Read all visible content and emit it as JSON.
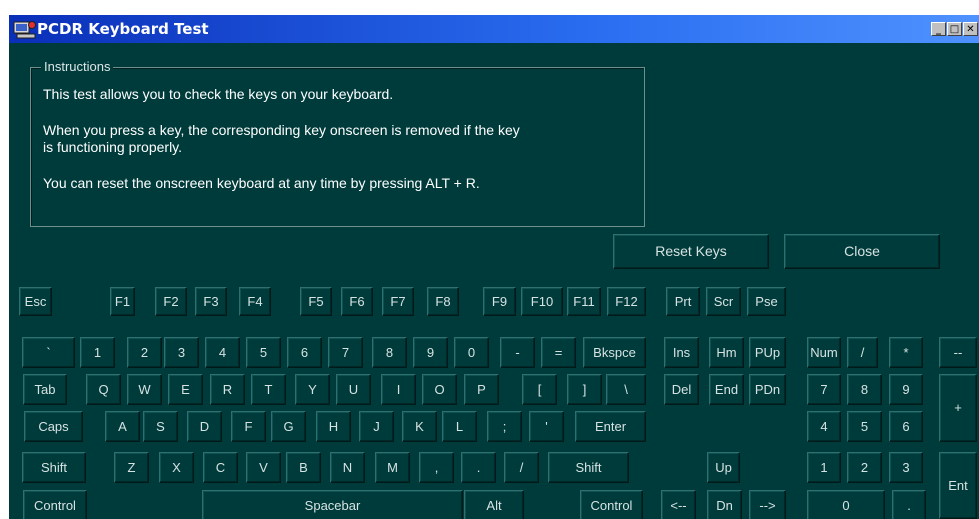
{
  "window": {
    "title": "PCDR Keyboard Test",
    "controls": {
      "minimize": "_",
      "maximize": "□",
      "close": "✕"
    }
  },
  "instructions": {
    "legend": "Instructions",
    "lines": [
      "This test allows you to check the keys on your keyboard.",
      "When you press a key, the corresponding key onscreen is removed if the key",
      "is functioning properly.",
      "You can reset the onscreen keyboard at any time by pressing ALT + R."
    ]
  },
  "buttons": {
    "reset": "Reset Keys",
    "close": "Close"
  },
  "keys": [
    {
      "id": "esc",
      "label": "Esc"
    },
    {
      "id": "f1",
      "label": "F1"
    },
    {
      "id": "f2",
      "label": "F2"
    },
    {
      "id": "f3",
      "label": "F3"
    },
    {
      "id": "f4",
      "label": "F4"
    },
    {
      "id": "f5",
      "label": "F5"
    },
    {
      "id": "f6",
      "label": "F6"
    },
    {
      "id": "f7",
      "label": "F7"
    },
    {
      "id": "f8",
      "label": "F8"
    },
    {
      "id": "f9",
      "label": "F9"
    },
    {
      "id": "f10",
      "label": "F10"
    },
    {
      "id": "f11",
      "label": "F11"
    },
    {
      "id": "f12",
      "label": "F12"
    },
    {
      "id": "prt",
      "label": "Prt"
    },
    {
      "id": "scr",
      "label": "Scr"
    },
    {
      "id": "pse",
      "label": "Pse"
    },
    {
      "id": "backtick",
      "label": "`"
    },
    {
      "id": "1",
      "label": "1"
    },
    {
      "id": "2",
      "label": "2"
    },
    {
      "id": "3",
      "label": "3"
    },
    {
      "id": "4",
      "label": "4"
    },
    {
      "id": "5",
      "label": "5"
    },
    {
      "id": "6",
      "label": "6"
    },
    {
      "id": "7",
      "label": "7"
    },
    {
      "id": "8",
      "label": "8"
    },
    {
      "id": "9",
      "label": "9"
    },
    {
      "id": "0",
      "label": "0"
    },
    {
      "id": "minus",
      "label": "-"
    },
    {
      "id": "equals",
      "label": "="
    },
    {
      "id": "bkspce",
      "label": "Bkspce"
    },
    {
      "id": "ins",
      "label": "Ins"
    },
    {
      "id": "hm",
      "label": "Hm"
    },
    {
      "id": "pup",
      "label": "PUp"
    },
    {
      "id": "num",
      "label": "Num"
    },
    {
      "id": "num-div",
      "label": "/"
    },
    {
      "id": "num-mul",
      "label": "*"
    },
    {
      "id": "num-minus",
      "label": "--"
    },
    {
      "id": "tab",
      "label": "Tab"
    },
    {
      "id": "q",
      "label": "Q"
    },
    {
      "id": "w",
      "label": "W"
    },
    {
      "id": "e",
      "label": "E"
    },
    {
      "id": "r",
      "label": "R"
    },
    {
      "id": "t",
      "label": "T"
    },
    {
      "id": "y",
      "label": "Y"
    },
    {
      "id": "u",
      "label": "U"
    },
    {
      "id": "i",
      "label": "I"
    },
    {
      "id": "o",
      "label": "O"
    },
    {
      "id": "p",
      "label": "P"
    },
    {
      "id": "lbracket",
      "label": "["
    },
    {
      "id": "rbracket",
      "label": "]"
    },
    {
      "id": "backslash",
      "label": "\\"
    },
    {
      "id": "del",
      "label": "Del"
    },
    {
      "id": "end",
      "label": "End"
    },
    {
      "id": "pdn",
      "label": "PDn"
    },
    {
      "id": "num7",
      "label": "7"
    },
    {
      "id": "num8",
      "label": "8"
    },
    {
      "id": "num9",
      "label": "9"
    },
    {
      "id": "num-plus",
      "label": "+"
    },
    {
      "id": "caps",
      "label": "Caps"
    },
    {
      "id": "a",
      "label": "A"
    },
    {
      "id": "s",
      "label": "S"
    },
    {
      "id": "d",
      "label": "D"
    },
    {
      "id": "f",
      "label": "F"
    },
    {
      "id": "g",
      "label": "G"
    },
    {
      "id": "h",
      "label": "H"
    },
    {
      "id": "j",
      "label": "J"
    },
    {
      "id": "k",
      "label": "K"
    },
    {
      "id": "l",
      "label": "L"
    },
    {
      "id": "semicolon",
      "label": ";"
    },
    {
      "id": "quote",
      "label": "'"
    },
    {
      "id": "enter",
      "label": "Enter"
    },
    {
      "id": "num4",
      "label": "4"
    },
    {
      "id": "num5",
      "label": "5"
    },
    {
      "id": "num6",
      "label": "6"
    },
    {
      "id": "lshift",
      "label": "Shift"
    },
    {
      "id": "z",
      "label": "Z"
    },
    {
      "id": "x",
      "label": "X"
    },
    {
      "id": "c",
      "label": "C"
    },
    {
      "id": "v",
      "label": "V"
    },
    {
      "id": "b",
      "label": "B"
    },
    {
      "id": "n",
      "label": "N"
    },
    {
      "id": "m",
      "label": "M"
    },
    {
      "id": "comma",
      "label": ","
    },
    {
      "id": "period",
      "label": "."
    },
    {
      "id": "slash",
      "label": "/"
    },
    {
      "id": "rshift",
      "label": "Shift"
    },
    {
      "id": "up",
      "label": "Up"
    },
    {
      "id": "num1",
      "label": "1"
    },
    {
      "id": "num2",
      "label": "2"
    },
    {
      "id": "num3",
      "label": "3"
    },
    {
      "id": "num-enter",
      "label": "Ent"
    },
    {
      "id": "lcontrol",
      "label": "Control"
    },
    {
      "id": "spacebar",
      "label": "Spacebar"
    },
    {
      "id": "alt",
      "label": "Alt"
    },
    {
      "id": "rcontrol",
      "label": "Control"
    },
    {
      "id": "left",
      "label": "<--"
    },
    {
      "id": "dn",
      "label": "Dn"
    },
    {
      "id": "right",
      "label": "-->"
    },
    {
      "id": "num0",
      "label": "0"
    },
    {
      "id": "num-dot",
      "label": "."
    }
  ]
}
